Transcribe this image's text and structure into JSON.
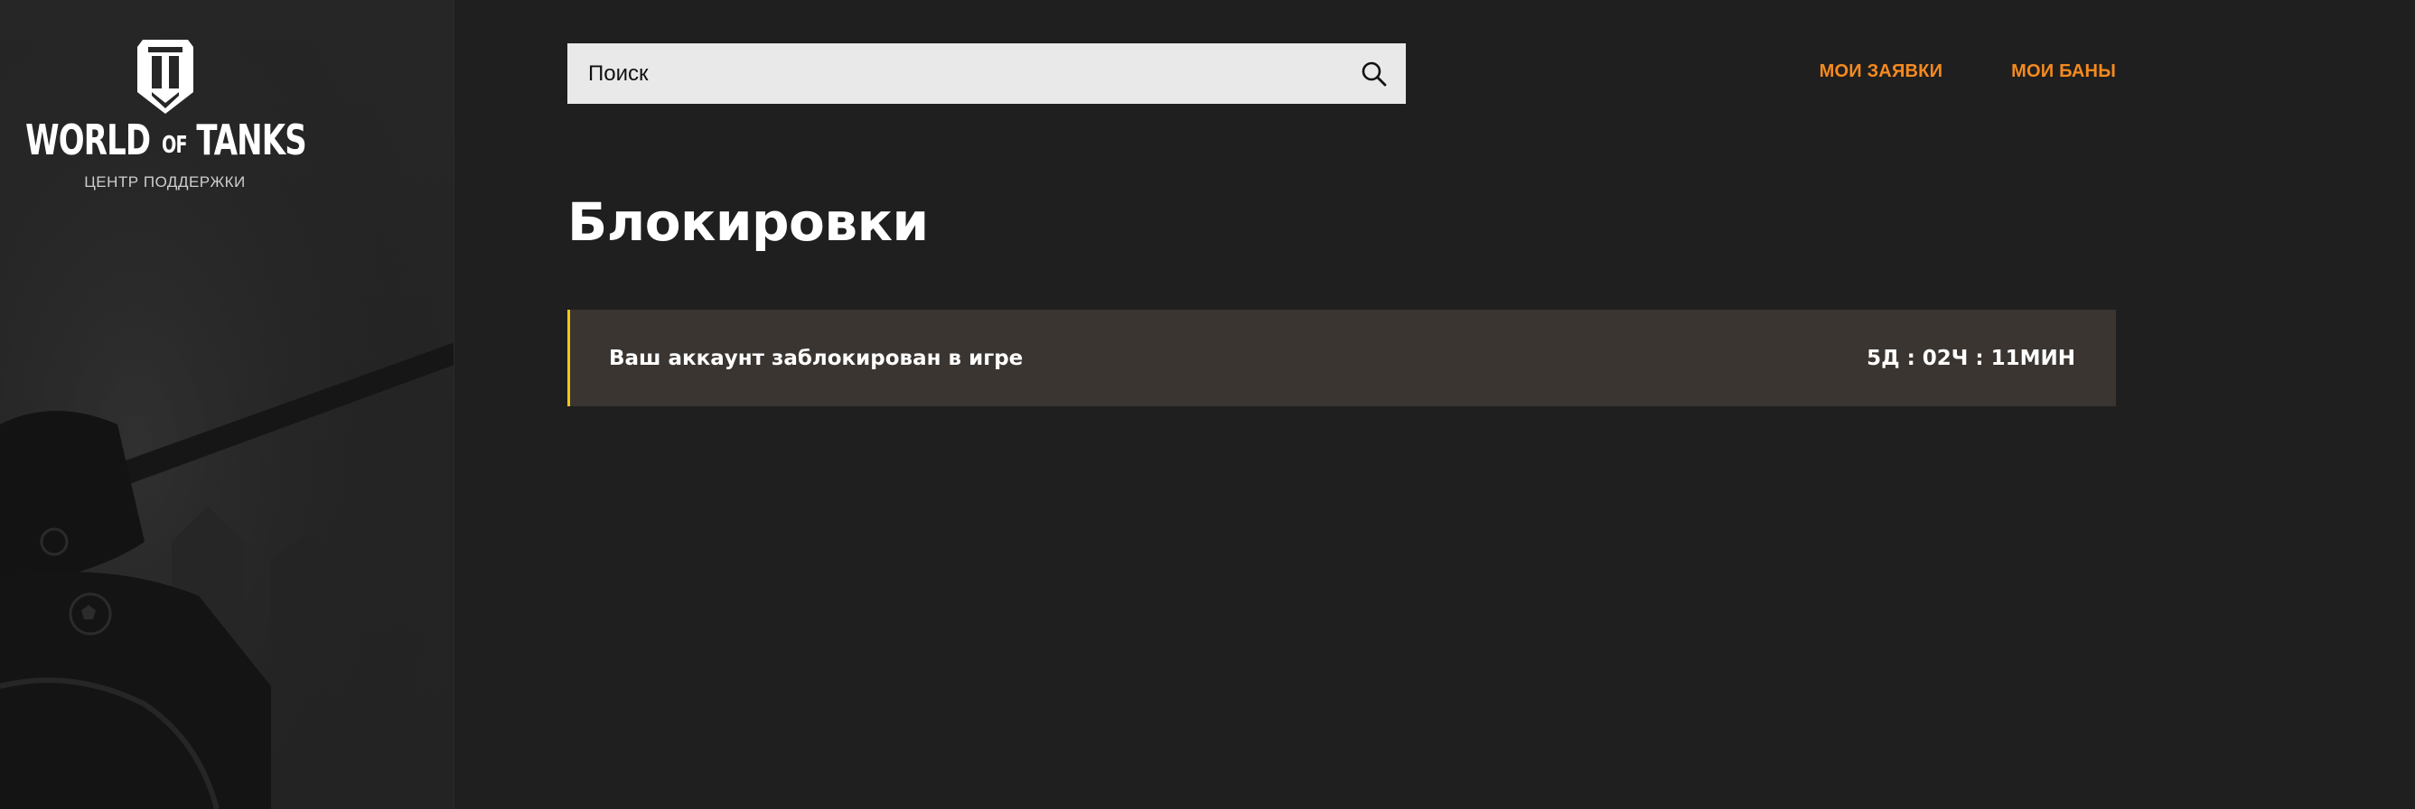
{
  "brand": {
    "wordmark_part1": "WORLD",
    "wordmark_part2": "OF",
    "wordmark_part3": "TANKS",
    "subtitle": "ЦЕНТР ПОДДЕРЖКИ"
  },
  "search": {
    "placeholder": "Поиск",
    "icon": "search-icon"
  },
  "nav": {
    "my_requests": "МОИ ЗАЯВКИ",
    "my_bans": "МОИ БАНЫ"
  },
  "page": {
    "title": "Блокировки"
  },
  "bans": [
    {
      "text": "Ваш аккаунт заблокирован в игре",
      "timer": "5Д : 02Ч : 11МИН"
    }
  ],
  "colors": {
    "background": "#1f1f1f",
    "sidebar": "#262626",
    "accent_orange": "#f58a1f",
    "ban_row_bg": "#3a3531",
    "ban_row_border": "#f5c518",
    "search_bg": "#e9e9e9"
  }
}
